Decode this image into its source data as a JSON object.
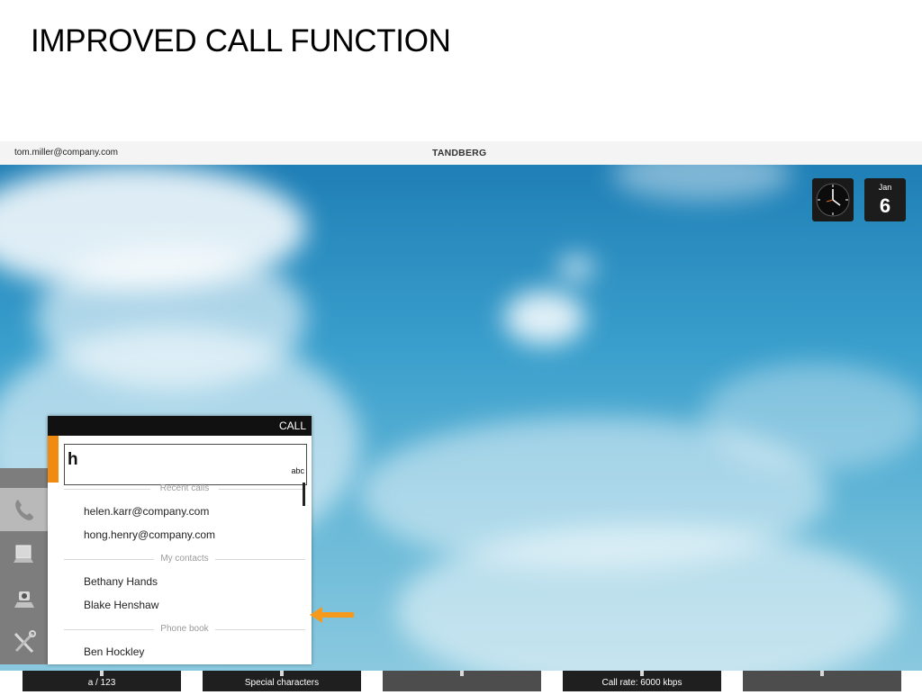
{
  "slide": {
    "title": "IMPROVED CALL FUNCTION"
  },
  "topbar": {
    "user": "tom.miller@company.com",
    "brand": "TANDBERG"
  },
  "date_widget": {
    "month": "Jan",
    "day": "6"
  },
  "sidebar": {
    "items": [
      {
        "icon": "phone-icon",
        "active": true
      },
      {
        "icon": "laptop-icon",
        "active": false
      },
      {
        "icon": "camera-icon",
        "active": false
      },
      {
        "icon": "tools-icon",
        "active": false
      }
    ]
  },
  "call_panel": {
    "header": "CALL",
    "input_value": "h",
    "input_mode": "abc",
    "sections": [
      {
        "caption": "Recent calls",
        "items": [
          "helen.karr@company.com",
          "hong.henry@company.com"
        ]
      },
      {
        "caption": "My contacts",
        "items": [
          "Bethany Hands",
          "Blake Henshaw"
        ]
      },
      {
        "caption": "Phone book",
        "items": [
          "Ben Hockley"
        ]
      }
    ]
  },
  "softkeys": [
    "a / 123",
    "Special characters",
    "",
    "Call rate: 6000 kbps",
    ""
  ],
  "colors": {
    "accent": "#f08a10",
    "header": "#111111",
    "softkey": "#1f1f1f"
  }
}
